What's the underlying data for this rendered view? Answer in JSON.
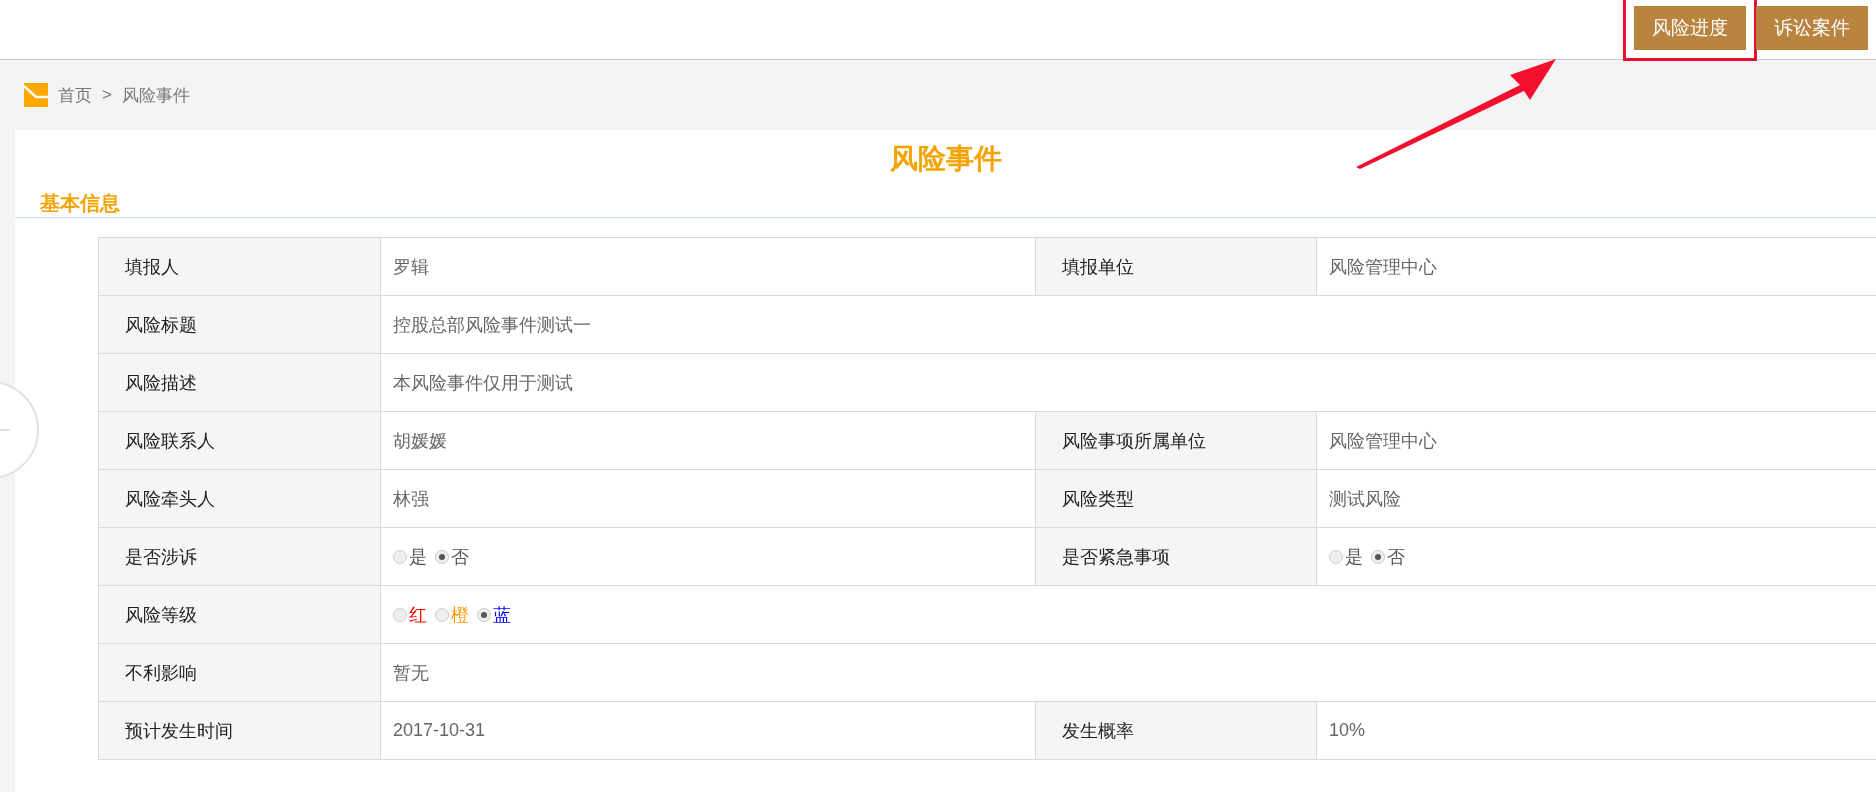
{
  "header": {
    "buttons": [
      {
        "label": "风险进度",
        "highlighted": true
      },
      {
        "label": "诉讼案件",
        "highlighted": false
      }
    ]
  },
  "breadcrumb": {
    "items": [
      "首页",
      "风险事件"
    ],
    "separator": ">"
  },
  "title": "风险事件",
  "section": "基本信息",
  "rows": [
    {
      "fields": [
        {
          "kind": "text",
          "label": "填报人",
          "value": "罗辑"
        },
        {
          "kind": "text",
          "label": "填报单位",
          "value": "风险管理中心"
        }
      ]
    },
    {
      "fields": [
        {
          "kind": "text",
          "label": "风险标题",
          "value": "控股总部风险事件测试一"
        }
      ]
    },
    {
      "fields": [
        {
          "kind": "text",
          "label": "风险描述",
          "value": "本风险事件仅用于测试"
        }
      ]
    },
    {
      "fields": [
        {
          "kind": "text",
          "label": "风险联系人",
          "value": "胡媛媛"
        },
        {
          "kind": "text",
          "label": "风险事项所属单位",
          "value": "风险管理中心"
        }
      ]
    },
    {
      "fields": [
        {
          "kind": "text",
          "label": "风险牵头人",
          "value": "林强"
        },
        {
          "kind": "text",
          "label": "风险类型",
          "value": "测试风险"
        }
      ]
    },
    {
      "fields": [
        {
          "kind": "radio",
          "label": "是否涉诉",
          "options": [
            {
              "label": "是",
              "selected": false
            },
            {
              "label": "否",
              "selected": true
            }
          ]
        },
        {
          "kind": "radio",
          "label": "是否紧急事项",
          "options": [
            {
              "label": "是",
              "selected": false
            },
            {
              "label": "否",
              "selected": true
            }
          ]
        }
      ]
    },
    {
      "fields": [
        {
          "kind": "radio",
          "label": "风险等级",
          "options": [
            {
              "label": "红",
              "selected": false,
              "color": "#ff0000"
            },
            {
              "label": "橙",
              "selected": false,
              "color": "#ff9900"
            },
            {
              "label": "蓝",
              "selected": true,
              "color": "#0000ff"
            }
          ]
        }
      ]
    },
    {
      "fields": [
        {
          "kind": "text",
          "label": "不利影响",
          "value": "暂无"
        }
      ]
    },
    {
      "fields": [
        {
          "kind": "text",
          "label": "预计发生时间",
          "value": "2017-10-31"
        },
        {
          "kind": "text",
          "label": "发生概率",
          "value": "10%"
        }
      ]
    }
  ]
}
